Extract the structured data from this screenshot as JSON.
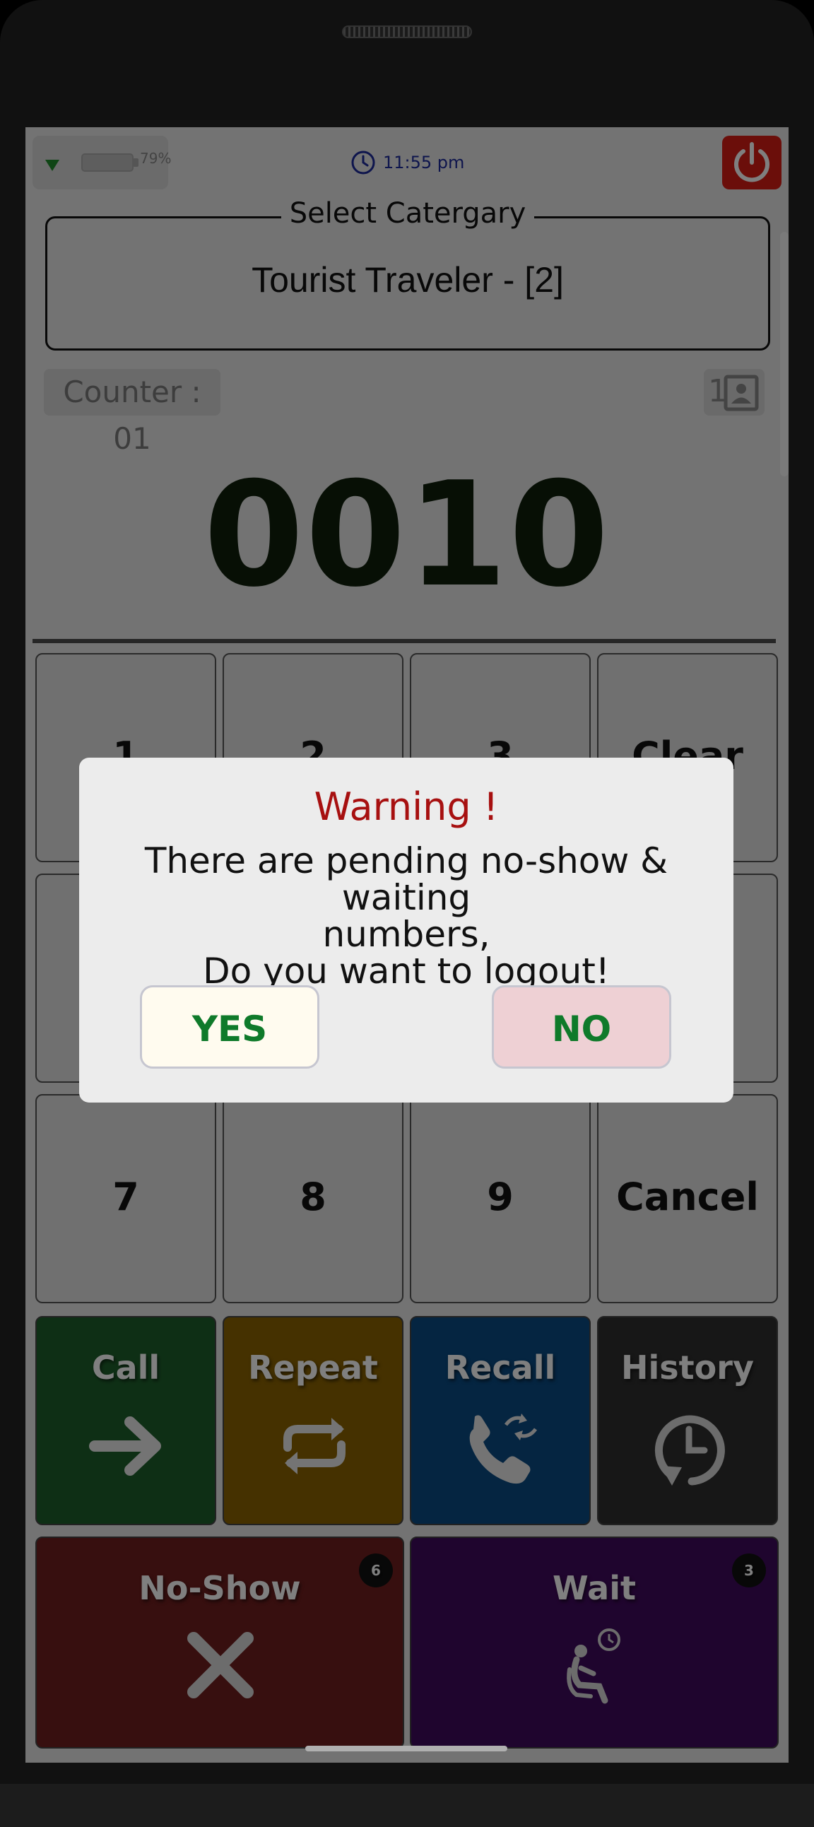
{
  "status_bar": {
    "battery": "79%",
    "time": "11:55 pm"
  },
  "category": {
    "legend": "Select Catergary",
    "value": "Tourist Traveler  - [2]"
  },
  "counter": {
    "label": "Counter : 01",
    "contacts_count": "1"
  },
  "ticket_number": "0010",
  "keypad": {
    "row1": [
      "1",
      "2",
      "3",
      "Clear"
    ],
    "row3": [
      "7",
      "8",
      "9",
      "Cancel"
    ]
  },
  "actions": {
    "call": "Call",
    "repeat": "Repeat",
    "recall": "Recall",
    "history": "History",
    "no_show": "No-Show",
    "no_show_count": "6",
    "wait": "Wait",
    "wait_count": "3"
  },
  "colors": {
    "call": "#1d5f2b",
    "repeat": "#8a6200",
    "recall": "#0a4a82",
    "history": "#2e2e2e",
    "no_show": "#6e1e1e",
    "wait": "#3f0a5c",
    "power": "#d71d14",
    "warning": "#a71010"
  },
  "dialog": {
    "title": "Warning !",
    "message_line1": "There are pending  no-show & waiting",
    "message_line2": "numbers,",
    "message_line3": "Do you want to logout!",
    "yes": "YES",
    "no": "NO"
  }
}
